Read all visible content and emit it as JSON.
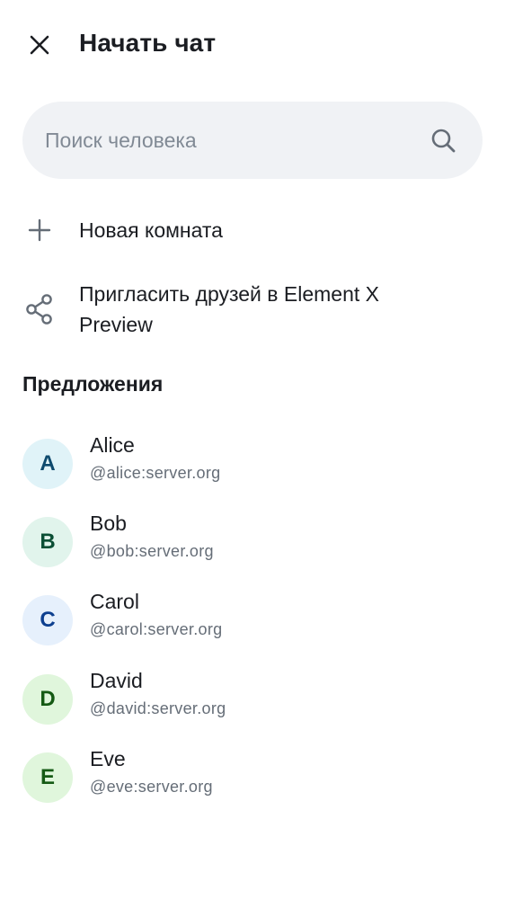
{
  "header": {
    "title": "Начать чат",
    "close_icon": "close-icon"
  },
  "search": {
    "placeholder": "Поиск человека",
    "value": "",
    "icon": "search-icon"
  },
  "actions": [
    {
      "label": "Новая комната",
      "icon": "plus-icon"
    },
    {
      "label_line1": "Пригласить друзей в Element X",
      "label_line2": "Preview",
      "icon": "share-icon"
    }
  ],
  "suggestions": {
    "title": "Предложения",
    "users": [
      {
        "initial": "A",
        "name": "Alice",
        "id": "@alice:server.org",
        "bg": "#e0f3f8",
        "fg": "#0e4a6e"
      },
      {
        "initial": "B",
        "name": "Bob",
        "id": "@bob:server.org",
        "bg": "#e1f4ec",
        "fg": "#0b4f35"
      },
      {
        "initial": "C",
        "name": "Carol",
        "id": "@carol:server.org",
        "bg": "#e6f0fc",
        "fg": "#0d3f8f"
      },
      {
        "initial": "D",
        "name": "David",
        "id": "@david:server.org",
        "bg": "#e0f6dc",
        "fg": "#155a14"
      },
      {
        "initial": "E",
        "name": "Eve",
        "id": "@eve:server.org",
        "bg": "#e0f6dc",
        "fg": "#155a14"
      }
    ]
  }
}
